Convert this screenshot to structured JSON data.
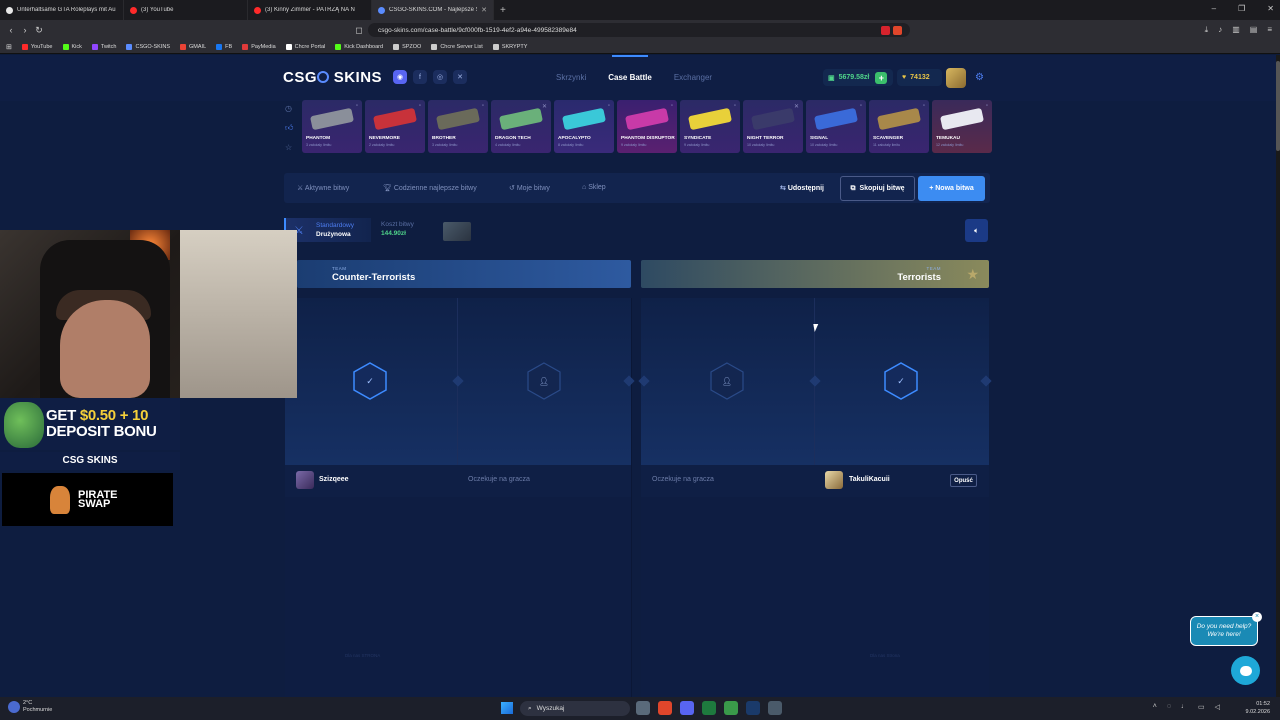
{
  "browser": {
    "tabs": [
      {
        "title": "Unterhaltsame GTA Roleplays mit Au",
        "color": "#e7e7e7"
      },
      {
        "title": "(3) YouTube",
        "color": "#ff2a2a"
      },
      {
        "title": "(3) Kinny Zimmer - PATRZĄ NA N",
        "color": "#ff2a2a"
      },
      {
        "title": "CSGO-SKINS.COM - Najlepsze Sk",
        "color": "#5a8cff",
        "active": true
      }
    ],
    "url": "csgo-skins.com/case-battle/9cf000fb-1519-4ef2-a94e-499582389e84",
    "bookmarks": [
      {
        "label": "YouTube",
        "color": "#ff2a2a"
      },
      {
        "label": "Kick",
        "color": "#53fc18"
      },
      {
        "label": "Twitch",
        "color": "#9146ff"
      },
      {
        "label": "CSGO-SKINS",
        "color": "#5a8cff"
      },
      {
        "label": "GMAIL",
        "color": "#ea4335"
      },
      {
        "label": "FB",
        "color": "#1877f2"
      },
      {
        "label": "PayMedia",
        "color": "#e03a3a"
      },
      {
        "label": "Chcre Portal",
        "color": "#ffffff"
      },
      {
        "label": "Kick Dashboard",
        "color": "#53fc18"
      },
      {
        "label": "SPZOO",
        "color": "#cccccc"
      },
      {
        "label": "Chcre Server List",
        "color": "#cccccc"
      },
      {
        "label": "SKRYPTY",
        "color": "#cccccc"
      }
    ]
  },
  "site": {
    "logo_left": "CSG",
    "logo_right": "SKINS",
    "nav": [
      {
        "label": "Skrzynki",
        "active": false
      },
      {
        "label": "Case Battle",
        "active": true
      },
      {
        "label": "Exchanger",
        "active": false
      }
    ],
    "balance": "5679.58zł",
    "coins": "74132"
  },
  "cases": [
    {
      "name": "PHANTOM",
      "sub": "3 założały limitu",
      "gun": "#8a8f9a"
    },
    {
      "name": "NEVERMORE",
      "sub": "2 założały limitu",
      "gun": "#c8323a"
    },
    {
      "name": "BROTHER",
      "sub": "3 założały limitu",
      "gun": "#6a6a5a"
    },
    {
      "name": "DRAGON TECH",
      "sub": "4 założały limitu",
      "gun": "#6ab07a"
    },
    {
      "name": "APOCALYPTO",
      "sub": "8 założały limitu",
      "gun": "#3ac8d8"
    },
    {
      "name": "PHANTOM DISRUPTOR",
      "sub": "9 założały limitu",
      "gun": "#c83aa8"
    },
    {
      "name": "SYNDICATE",
      "sub": "9 założały limitu",
      "gun": "#e8d03a"
    },
    {
      "name": "NIGHT TERROR",
      "sub": "10 założały limitu",
      "gun": "#3a3a6a"
    },
    {
      "name": "SIGNAL",
      "sub": "10 założały limitu",
      "gun": "#3a6ad8"
    },
    {
      "name": "SCAVENGER",
      "sub": "11 założały limitu",
      "gun": "#a8884a"
    },
    {
      "name": "TEMUKAU",
      "sub": "12 założały limitu",
      "gun": "#e8e8f0"
    }
  ],
  "toolbar": {
    "active_battles": "Aktywne bitwy",
    "daily_best": "Codzienne najlepsze bitwy",
    "my_battles": "Moje bitwy",
    "shop": "Sklep",
    "share": "Udostępnij",
    "copy": "Skopiuj bitwę",
    "new": "+ Nowa bitwa"
  },
  "battle": {
    "mode_line1": "Standardowy",
    "mode_line2": "Drużynowa",
    "cost_label": "Koszt bitwy",
    "cost_value": "144.90zł",
    "team_label": "TEAM",
    "team_ct": "Counter-Terrorists",
    "team_t": "Terrorists",
    "player1": "Szizqeee",
    "waiting1": "Oczekuje na gracza",
    "waiting2": "Oczekuje na gracza",
    "player4": "TakuliKacuii",
    "leave": "Opuść",
    "foot_ct": "Dla nas STRONA",
    "foot_t": "Dla nas Strona"
  },
  "stream_overlay": {
    "ad_line1_a": "GET ",
    "ad_line1_b": "$0.50 + 10",
    "ad_line2": "DEPOSIT BONU",
    "ad_brand": "CSG SKINS",
    "pirate_line1": "PIRATE",
    "pirate_line2": "SWAP"
  },
  "chat": {
    "help_line1": "Do you need help?",
    "help_line2": "We're here!"
  },
  "taskbar": {
    "temp": "2°C",
    "weather": "Pochmurnie",
    "search": "Wyszukaj",
    "time": "01:52",
    "date": "9.02.2026"
  }
}
